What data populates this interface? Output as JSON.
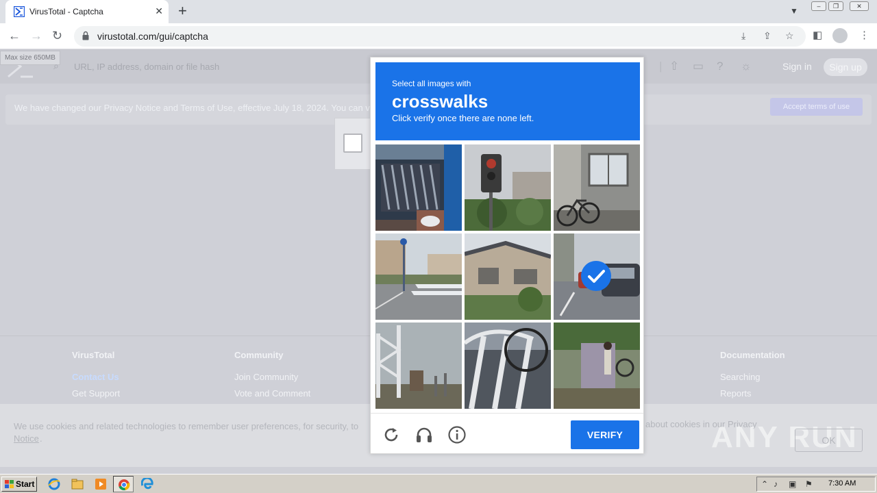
{
  "browser": {
    "tab_title": "VirusTotal - Captcha",
    "url": "virustotal.com/gui/captcha"
  },
  "page": {
    "max_size_label": "Max size 650MB",
    "search_placeholder": "URL, IP address, domain or file hash",
    "sign_in": "Sign in",
    "sign_up": "Sign up",
    "privacy_notice": "We have changed our Privacy Notice and Terms of Use, effective July 18, 2024. You can v",
    "accept_terms": "Accept terms of use"
  },
  "footer": {
    "col1_heading": "VirusTotal",
    "col1_links": [
      "Contact Us",
      "Get Support"
    ],
    "col2_heading": "Community",
    "col2_links": [
      "Join Community",
      "Vote and Comment"
    ],
    "col3_heading": "Documentation",
    "col3_links": [
      "Searching",
      "Reports"
    ]
  },
  "cookie": {
    "text_start": "We use cookies and related technologies to remember user preferences, for security, to",
    "text_end": "about cookies in our Privacy",
    "notice_link": "Notice",
    "notice_suffix": ".",
    "ok": "OK",
    "watermark": "ANY RUN"
  },
  "captcha": {
    "line1": "Select all images with",
    "target": "crosswalks",
    "line3": "Click verify once there are none left.",
    "verify": "VERIFY",
    "selected_tiles": [
      5
    ]
  },
  "taskbar": {
    "start": "Start",
    "time": "7:30 AM"
  }
}
